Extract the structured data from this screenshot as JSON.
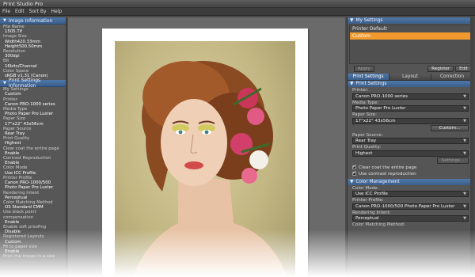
{
  "app": {
    "title": "Print Studio Pro"
  },
  "menu": [
    "File",
    "Edit",
    "Sort By",
    "Help"
  ],
  "image_info": {
    "header": "Image Information",
    "items": [
      {
        "k": "File Name",
        "v": "1505.Tif"
      },
      {
        "k": "Image Size",
        "v": "Width420.33mm Height500.50mm"
      },
      {
        "k": "Resolution",
        "v": "300dpi"
      },
      {
        "k": "Bit",
        "v": "16bits/Channel"
      },
      {
        "k": "Color Space",
        "v": "sRGB v1.31 (Canon)"
      }
    ]
  },
  "print_info": {
    "header": "Print Settings Information",
    "items": [
      {
        "k": "My Settings",
        "v": "Custom"
      },
      {
        "k": "Printer",
        "v": "Canon PRO-1000 series"
      },
      {
        "k": "Media Type",
        "v": "Photo Paper Pro Luster"
      },
      {
        "k": "Paper Size",
        "v": "17\"x22\" 43x56cm"
      },
      {
        "k": "Paper Source",
        "v": "Rear Tray"
      },
      {
        "k": "Print Quality",
        "v": "Highest"
      },
      {
        "k": "Clear coat the entire page",
        "v": "Enable"
      },
      {
        "k": "Contrast Reproduction",
        "v": "Enable"
      },
      {
        "k": "Color Mode",
        "v": "Use ICC Profile"
      },
      {
        "k": "Printer Profile",
        "v": "Canon PRO-1000/500 Photo Paper Pro Luster"
      },
      {
        "k": "Rendering Intent",
        "v": "Perceptual"
      },
      {
        "k": "Color Matching Method",
        "v": "OS Standard CMM"
      },
      {
        "k": "Use black point compensation",
        "v": "Enable"
      },
      {
        "k": "Enable soft proofing",
        "v": "Disable"
      },
      {
        "k": "Registered Layouts",
        "v": "Custom"
      },
      {
        "k": "Fit to paper size",
        "v": "Enable"
      },
      {
        "k": "Print the image in a size",
        "v": ""
      }
    ]
  },
  "my_settings": {
    "header": "My Settings",
    "items": [
      "Printer Default",
      "Custom"
    ],
    "selected": 1,
    "apply_label": "Apply",
    "register_label": "Register",
    "edit_label": "Edit"
  },
  "tabs": [
    "Print Settings",
    "Layout",
    "Correction"
  ],
  "print_settings": {
    "header": "Print Settings",
    "printer_label": "Printer:",
    "printer_value": "Canon PRO-1000 series",
    "media_label": "Media Type:",
    "media_value": "Photo Paper Pro Luster",
    "paper_size_label": "Paper Size:",
    "paper_size_value": "17\"x22\" 43x56cm",
    "custom_label": "Custom...",
    "paper_source_label": "Paper Source:",
    "paper_source_value": "Rear Tray",
    "quality_label": "Print Quality:",
    "quality_value": "Highest",
    "settings_label": "Settings...",
    "clear_coat_label": "Clear coat the entire page",
    "contrast_label": "Use contrast reproduction"
  },
  "color_mgmt": {
    "header": "Color Management",
    "color_mode_label": "Color Mode:",
    "color_mode_value": "Use ICC Profile",
    "profile_label": "Printer Profile:",
    "profile_value": "Canon PRO-1000/500 Photo Paper Pro Luster",
    "intent_label": "Rendering Intent:",
    "intent_value": "Perceptual",
    "method_label": "Color Matching Method:"
  }
}
